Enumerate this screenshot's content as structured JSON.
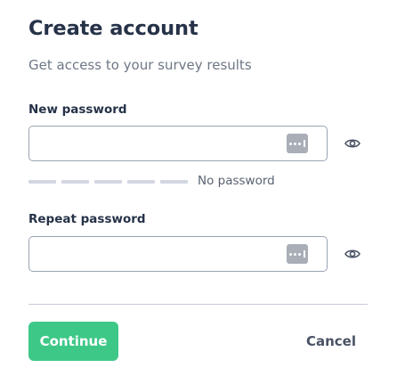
{
  "header": {
    "title": "Create account",
    "subtitle": "Get access to your survey results"
  },
  "fields": {
    "new_password": {
      "label": "New password",
      "value": "",
      "placeholder": ""
    },
    "repeat_password": {
      "label": "Repeat password",
      "value": "",
      "placeholder": ""
    }
  },
  "strength": {
    "segments_total": 5,
    "segments_filled": 0,
    "label": "No password"
  },
  "actions": {
    "continue_label": "Continue",
    "cancel_label": "Cancel"
  },
  "icons": {
    "password_manager": "password-manager-icon",
    "toggle_visibility": "eye-icon"
  },
  "colors": {
    "primary": "#3ec888",
    "text": "#263248",
    "muted": "#6e7786",
    "border": "#9aa3b2",
    "strength_empty": "#d3d7e2"
  }
}
